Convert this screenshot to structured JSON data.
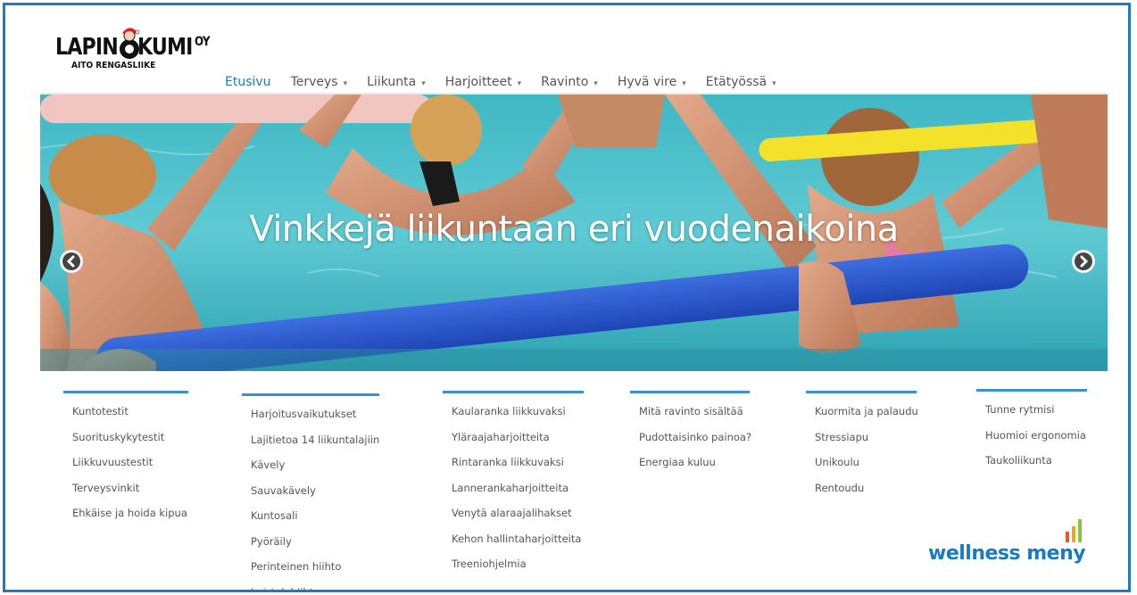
{
  "brand": {
    "logo_main": "LAPIN",
    "logo_main2": "KUMI",
    "logo_suffix": "OY",
    "logo_tagline": "AITO RENGASLIIKE"
  },
  "nav": {
    "items": [
      {
        "label": "Etusivu",
        "active": true,
        "dropdown": false
      },
      {
        "label": "Terveys",
        "dropdown": true
      },
      {
        "label": "Liikunta",
        "dropdown": true
      },
      {
        "label": "Harjoitteet",
        "dropdown": true
      },
      {
        "label": "Ravinto",
        "dropdown": true
      },
      {
        "label": "Hyvä vire",
        "dropdown": true
      },
      {
        "label": "Etätyössä",
        "dropdown": true
      }
    ],
    "caret": "▾"
  },
  "hero": {
    "title": "Vinkkejä liikuntaan eri vuodenaikoina",
    "prev_icon": "chevron-left-icon",
    "next_icon": "chevron-right-icon"
  },
  "columns": [
    {
      "items": [
        "Kuntotestit",
        "Suorituskykytestit",
        "Liikkuvuustestit",
        "Terveysvinkit",
        "Ehkäise ja hoida kipua"
      ]
    },
    {
      "items": [
        "Harjoitusvaikutukset",
        "Lajitietoa 14 liikuntalajiin",
        "Kävely",
        "Sauvakävely",
        "Kuntosali",
        "Pyöräily",
        "Perinteinen hiihto",
        "Luisteluhiihto"
      ]
    },
    {
      "items": [
        "Kaularanka liikkuvaksi",
        "Yläraajaharjoitteita",
        "Rintaranka liikkuvaksi",
        "Lannerankaharjoitteita",
        "Venytä alaraajalihakset",
        "Kehon hallintaharjoitteita",
        "Treeniohjelmia"
      ]
    },
    {
      "items": [
        "Mitä ravinto sisältää",
        "Pudottaisinko painoa?",
        "Energiaa kuluu"
      ]
    },
    {
      "items": [
        "Kuormita ja palaudu",
        "Stressiapu",
        "Unikoulu",
        "Rentoudu"
      ]
    },
    {
      "items": [
        "Tunne rytmisi",
        "Huomioi ergonomia",
        "Taukoliikunta"
      ]
    }
  ],
  "footer": {
    "wellness_logo": "wellness meny"
  },
  "colors": {
    "accent": "#1a7bc0",
    "frame": "#1e78c2",
    "rule": "#3c8fd0"
  }
}
